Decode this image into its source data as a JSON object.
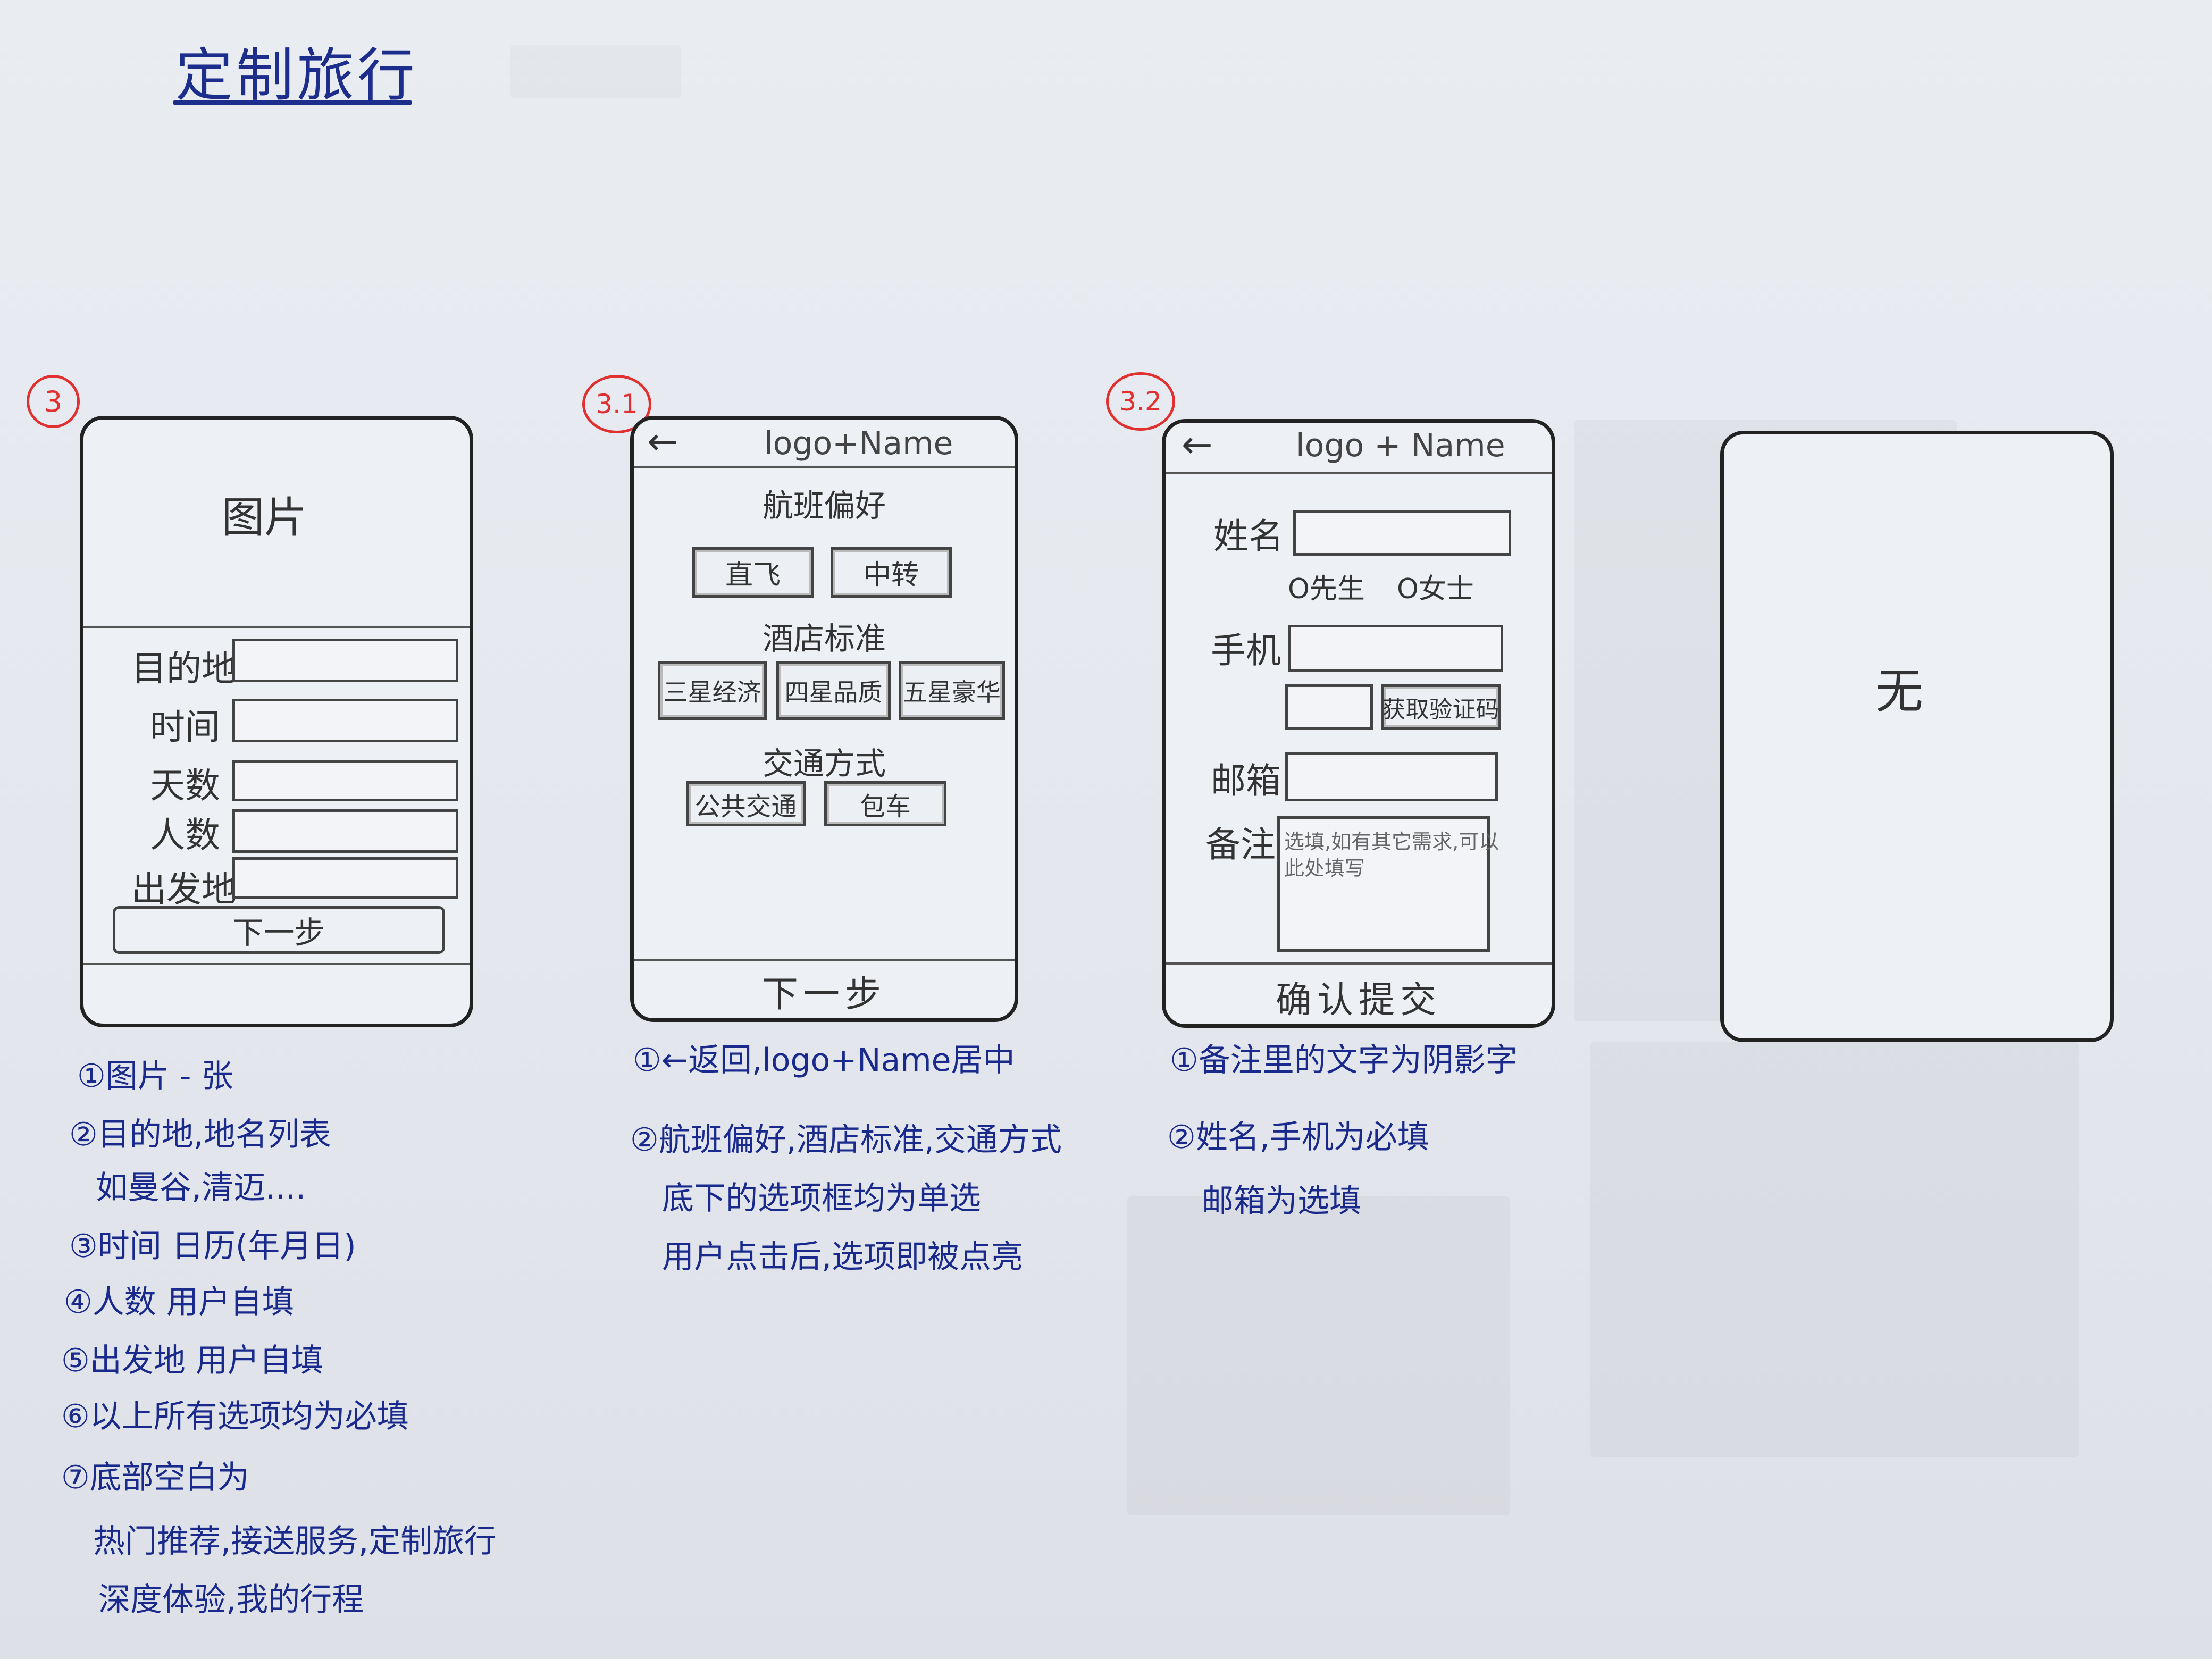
{
  "title": "定制旅行",
  "screens": {
    "s3": {
      "number": "3",
      "image_label": "图片",
      "fields": [
        "目的地",
        "时间",
        "天数",
        "人数",
        "出发地"
      ],
      "next_button": "下一步"
    },
    "s31": {
      "number": "3.1",
      "header": "logo+Name",
      "back": "←",
      "flight_title": "航班偏好",
      "flight_options": [
        "直飞",
        "中转"
      ],
      "hotel_title": "酒店标准",
      "hotel_options": [
        "三星经济",
        "四星品质",
        "五星豪华"
      ],
      "transport_title": "交通方式",
      "transport_options": [
        "公共交通",
        "包车"
      ],
      "bottom": "下一步"
    },
    "s32": {
      "number": "3.2",
      "header": "logo + Name",
      "back": "←",
      "name_label": "姓名",
      "gender_male": "O先生",
      "gender_female": "O女士",
      "phone_label": "手机",
      "verify_button": "获取验证码",
      "email_label": "邮箱",
      "remark_label": "备注",
      "remark_placeholder_line1": "选填,如有其它需求,可以",
      "remark_placeholder_line2": "此处填写",
      "bottom": "确认提交"
    },
    "s4": {
      "content": "无"
    }
  },
  "notes": {
    "s3": [
      "①图片 - 张",
      "②目的地,地名列表",
      "如曼谷,清迈....",
      "③时间 日历(年月日)",
      "④人数 用户自填",
      "⑤出发地 用户自填",
      "⑥以上所有选项均为必填",
      "⑦底部空白为",
      "热门推荐,接送服务,定制旅行",
      "深度体验,我的行程"
    ],
    "s31": [
      "①←返回,logo+Name居中",
      "②航班偏好,酒店标准,交通方式",
      "底下的选项框均为单选",
      "用户点击后,选项即被点亮"
    ],
    "s32": [
      "①备注里的文字为阴影字",
      "②姓名,手机为必填",
      "邮箱为选填"
    ]
  }
}
